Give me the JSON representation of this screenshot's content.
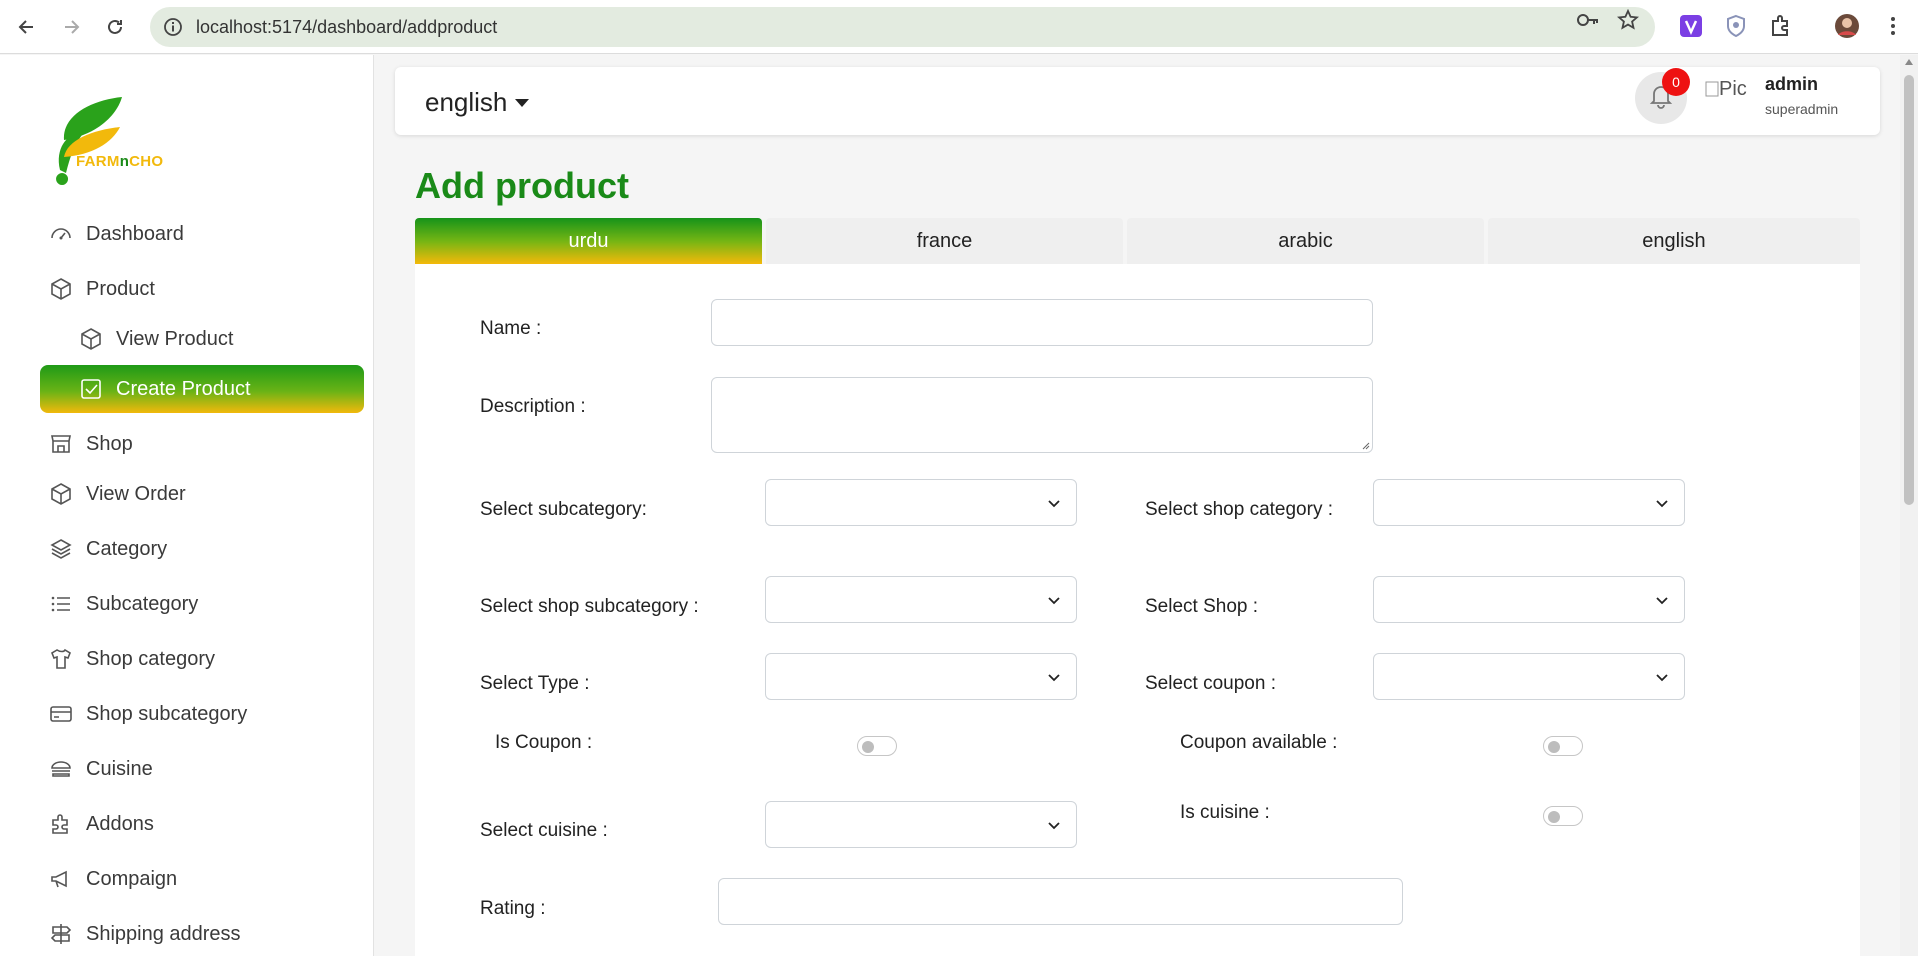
{
  "browser": {
    "url": "localhost:5174/dashboard/addproduct",
    "icons": [
      "back-arrow-icon",
      "forward-arrow-icon",
      "reload-icon",
      "site-info-icon",
      "password-key-icon",
      "bookmark-star-icon",
      "extension-v-icon",
      "shield-extension-icon",
      "puzzle-extension-icon",
      "profile-avatar-icon",
      "kebab-menu-icon"
    ]
  },
  "sidebar": {
    "logo_text_left": "FARM",
    "logo_text_mid": "n",
    "logo_text_right": "CHO",
    "items": [
      {
        "label": "Dashboard",
        "icon": "speedometer-icon"
      },
      {
        "label": "Product",
        "icon": "cube-icon"
      },
      {
        "label": "View Product",
        "icon": "cube-icon"
      },
      {
        "label": "Create Product",
        "icon": "check-square-icon",
        "active": true
      },
      {
        "label": "Shop",
        "icon": "storefront-icon"
      },
      {
        "label": "View Order",
        "icon": "cube-icon"
      },
      {
        "label": "Category",
        "icon": "layers-icon"
      },
      {
        "label": "Subcategory",
        "icon": "list-icon"
      },
      {
        "label": "Shop category",
        "icon": "shirt-icon"
      },
      {
        "label": "Shop subcategory",
        "icon": "credit-card-icon"
      },
      {
        "label": "Cuisine",
        "icon": "burger-icon"
      },
      {
        "label": "Addons",
        "icon": "puzzle-icon"
      },
      {
        "label": "Compaign",
        "icon": "megaphone-icon"
      },
      {
        "label": "Shipping address",
        "icon": "signpost-icon"
      }
    ]
  },
  "topbar": {
    "language": "english",
    "notification_count": "0",
    "avatar_alt": "Pic",
    "user_name": "admin",
    "user_role": "superadmin"
  },
  "main": {
    "title": "Add product",
    "tabs": [
      "urdu",
      "france",
      "arabic",
      "english"
    ],
    "active_tab": "urdu"
  },
  "form": {
    "name_label": "Name :",
    "name_value": "",
    "description_label": "Description :",
    "description_value": "",
    "subcategory_label": "Select subcategory:",
    "shop_category_label": "Select shop category :",
    "shop_subcategory_label": "Select shop subcategory :",
    "shop_label": "Select Shop :",
    "type_label": "Select Type :",
    "coupon_label": "Select coupon :",
    "is_coupon_label": "Is Coupon :",
    "is_coupon": false,
    "coupon_available_label": "Coupon available :",
    "coupon_available": false,
    "cuisine_label": "Select cuisine :",
    "is_cuisine_label": "Is cuisine :",
    "is_cuisine": false,
    "rating_label": "Rating :",
    "rating_value": ""
  },
  "colors": {
    "brand_green": "#1a8a18",
    "brand_yellow": "#f2b90c",
    "badge_red": "#ee1111"
  }
}
